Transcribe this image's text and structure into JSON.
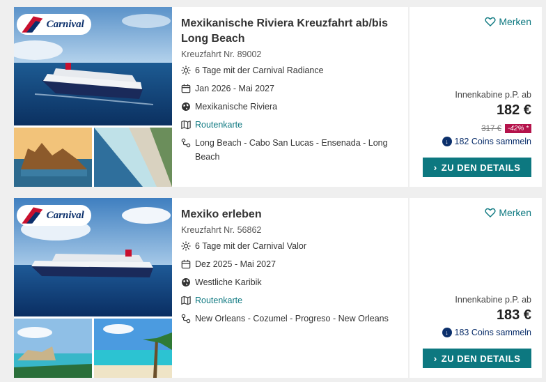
{
  "brand": {
    "logo_text": "Carnival"
  },
  "colors": {
    "accent": "#0d7880",
    "badge": "#b5134b",
    "coins": "#0b2f6b"
  },
  "cruises": [
    {
      "title": "Mexikanische Riviera Kreuzfahrt ab/bis Long Beach",
      "number": "Kreuzfahrt Nr. 89002",
      "ship": "6 Tage mit der Carnival Radiance",
      "dates": "Jan 2026 - Mai 2027",
      "region": "Mexikanische Riviera",
      "route_map": "Routenkarte",
      "route": "Long Beach - Cabo San Lucas - Ensenada - Long Beach",
      "save_label": "Merken",
      "cabin_label": "Innenkabine p.P. ab",
      "price": "182 €",
      "old_price": "317 €",
      "discount": "-42% *",
      "coins": "182 Coins sammeln",
      "details_label": "ZU DEN DETAILS"
    },
    {
      "title": "Mexiko erleben",
      "number": "Kreuzfahrt Nr. 56862",
      "ship": "6 Tage mit der Carnival Valor",
      "dates": "Dez 2025 - Mai 2027",
      "region": "Westliche Karibik",
      "route_map": "Routenkarte",
      "route": "New Orleans - Cozumel - Progreso - New Orleans",
      "save_label": "Merken",
      "cabin_label": "Innenkabine p.P. ab",
      "price": "183 €",
      "coins": "183 Coins sammeln",
      "details_label": "ZU DEN DETAILS"
    }
  ]
}
